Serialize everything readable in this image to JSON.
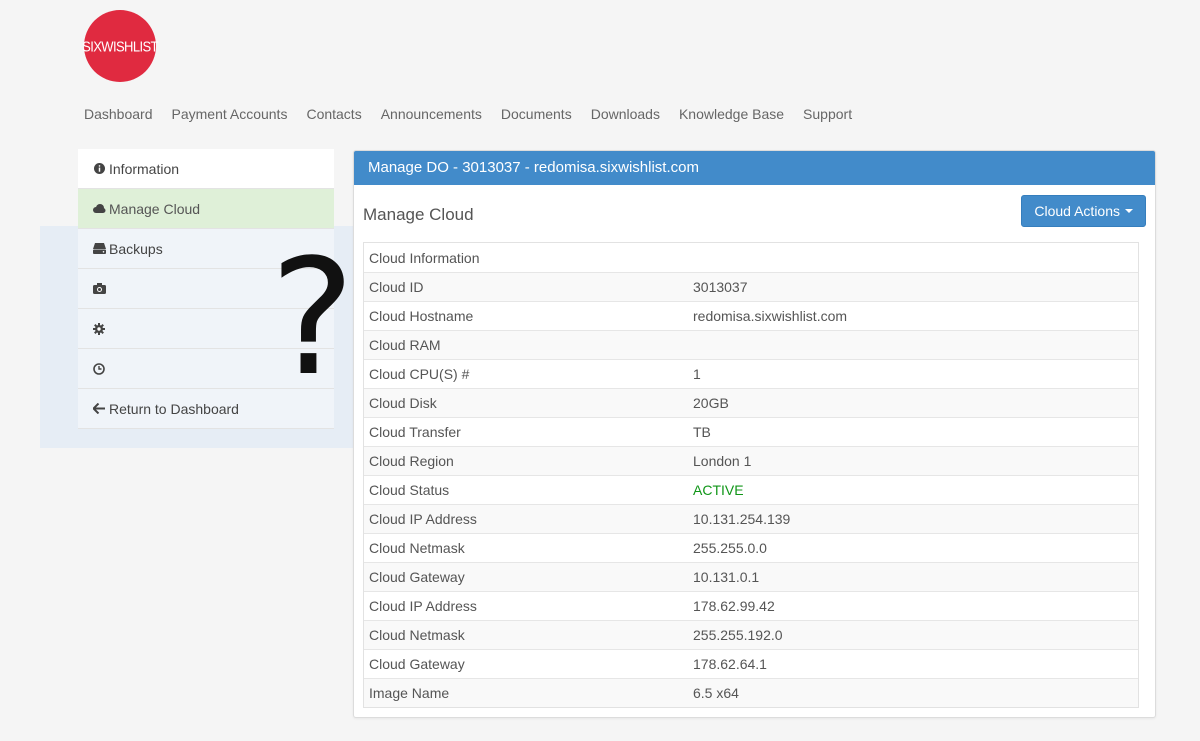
{
  "brand": {
    "logo_text": "SIXWISHLIST",
    "color": "#e02a40"
  },
  "topnav": [
    "Dashboard",
    "Payment Accounts",
    "Contacts",
    "Announcements",
    "Documents",
    "Downloads",
    "Knowledge Base",
    "Support"
  ],
  "sidebar": {
    "items": [
      {
        "label": "Information",
        "icon": "info-circle-icon"
      },
      {
        "label": "Manage Cloud",
        "icon": "cloud-icon",
        "active": true
      },
      {
        "label": "Backups",
        "icon": "hdd-icon"
      },
      {
        "label": "",
        "icon": "camera-icon"
      },
      {
        "label": "",
        "icon": "gear-icon"
      },
      {
        "label": "",
        "icon": "clock-icon"
      },
      {
        "label": "Return to Dashboard",
        "icon": "arrow-left-icon"
      }
    ]
  },
  "overlay": {
    "mark": "?"
  },
  "panel": {
    "heading": "Manage DO - 3013037 - redomisa.sixwishlist.com",
    "title": "Manage Cloud",
    "actions_label": "Cloud Actions",
    "accent": "#428bca"
  },
  "table": {
    "rows": [
      {
        "key": "Cloud Information",
        "value": ""
      },
      {
        "key": "Cloud ID",
        "value": "3013037"
      },
      {
        "key": "Cloud Hostname",
        "value": "redomisa.sixwishlist.com"
      },
      {
        "key": "Cloud RAM",
        "value": ""
      },
      {
        "key": "Cloud CPU(S) #",
        "value": "1"
      },
      {
        "key": "Cloud Disk",
        "value": "20GB"
      },
      {
        "key": "Cloud Transfer",
        "value": "TB"
      },
      {
        "key": "Cloud Region",
        "value": "London 1"
      },
      {
        "key": "Cloud Status",
        "value": "ACTIVE",
        "status_color": "#109618"
      },
      {
        "key": "Cloud IP Address",
        "value": "10.131.254.139"
      },
      {
        "key": "Cloud Netmask",
        "value": "255.255.0.0"
      },
      {
        "key": "Cloud Gateway",
        "value": "10.131.0.1"
      },
      {
        "key": "Cloud IP Address",
        "value": "178.62.99.42"
      },
      {
        "key": "Cloud Netmask",
        "value": "255.255.192.0"
      },
      {
        "key": "Cloud Gateway",
        "value": "178.62.64.1"
      },
      {
        "key": "Image Name",
        "value": "6.5 x64"
      }
    ]
  }
}
